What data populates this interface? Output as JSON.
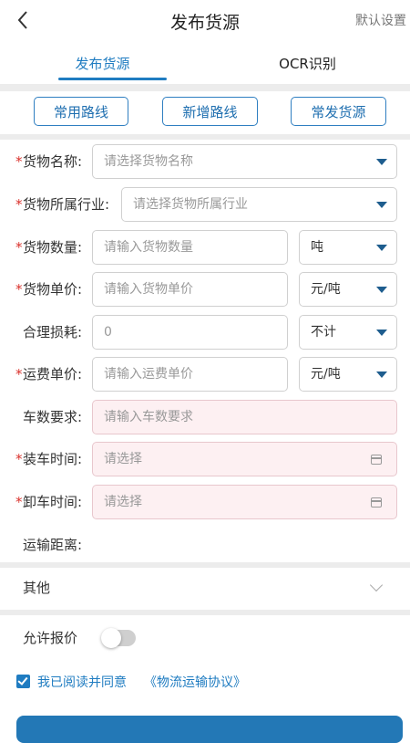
{
  "header": {
    "title": "发布货源",
    "right_link": "默认设置"
  },
  "tabs": [
    {
      "label": "发布货源",
      "active": true
    },
    {
      "label": "OCR识别",
      "active": false
    }
  ],
  "shortcuts": [
    {
      "label": "常用路线"
    },
    {
      "label": "新增路线"
    },
    {
      "label": "常发货源"
    }
  ],
  "form": {
    "goods_name": {
      "label": "货物名称:",
      "required": true,
      "placeholder": "请选择货物名称"
    },
    "industry": {
      "label": "货物所属行业:",
      "required": true,
      "placeholder": "请选择货物所属行业"
    },
    "quantity": {
      "label": "货物数量:",
      "required": true,
      "placeholder": "请输入货物数量",
      "unit": "吨"
    },
    "unit_price": {
      "label": "货物单价:",
      "required": true,
      "placeholder": "请输入货物单价",
      "unit": "元/吨"
    },
    "loss": {
      "label": "合理损耗:",
      "required": false,
      "value": "0",
      "unit": "不计"
    },
    "freight_price": {
      "label": "运费单价:",
      "required": true,
      "placeholder": "请输入运费单价",
      "unit": "元/吨"
    },
    "vehicle_count": {
      "label": "车数要求:",
      "required": false,
      "placeholder": "请输入车数要求"
    },
    "load_time": {
      "label": "装车时间:",
      "required": true,
      "placeholder": "请选择"
    },
    "unload_time": {
      "label": "卸车时间:",
      "required": true,
      "placeholder": "请选择"
    },
    "distance": {
      "label": "运输距离:"
    }
  },
  "other": {
    "label": "其他"
  },
  "allow_quote": {
    "label": "允许报价",
    "enabled": false
  },
  "agreement": {
    "checked": true,
    "text": "我已阅读并同意",
    "link": "《物流运输协议》"
  },
  "colors": {
    "accent": "#1f7cc1",
    "required": "#d9302b",
    "pink_field": "#fdf0f2"
  },
  "icons": [
    "back-icon",
    "caret-down-icon",
    "calendar-icon",
    "chevron-down-icon",
    "checkbox-checked-icon"
  ]
}
